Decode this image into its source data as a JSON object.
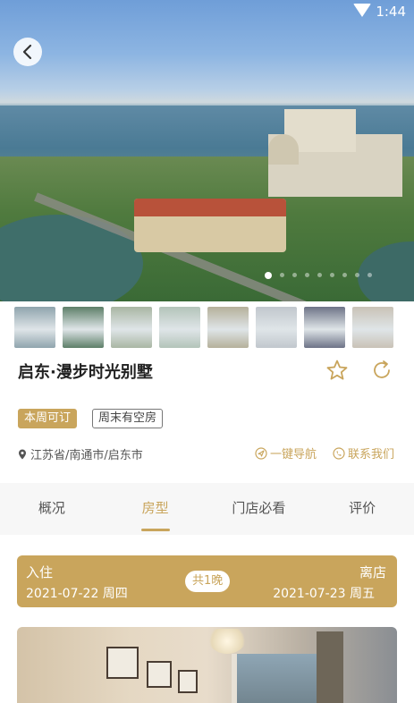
{
  "status_bar": {
    "time": "1:44",
    "wifi_icon": "wifi-icon"
  },
  "hero": {
    "carousel_count": 9,
    "active_index": 0
  },
  "thumbnails": [
    {
      "color": "#8fa4ad"
    },
    {
      "color": "#5d7f68"
    },
    {
      "color": "#a9b6a3"
    },
    {
      "color": "#b3c4b9"
    },
    {
      "color": "#b5b09a"
    },
    {
      "color": "#c1c7cd"
    },
    {
      "color": "#6d7387"
    },
    {
      "color": "#c9c2b6"
    }
  ],
  "title": "启东·漫步时光别墅",
  "tags": [
    "本周可订",
    "周末有空房"
  ],
  "location": "江苏省/南通市/启东市",
  "actions": {
    "navigate": "一键导航",
    "contact": "联系我们"
  },
  "tabs": [
    {
      "label": "概况",
      "active": false
    },
    {
      "label": "房型",
      "active": true
    },
    {
      "label": "门店必看",
      "active": false
    },
    {
      "label": "评价",
      "active": false
    }
  ],
  "booking": {
    "checkin_label": "入住",
    "checkin_date": "2021-07-22 周四",
    "checkout_label": "离店",
    "checkout_date": "2021-07-23 周五",
    "nights": "共1晚"
  },
  "colors": {
    "accent": "#c9a55c"
  }
}
